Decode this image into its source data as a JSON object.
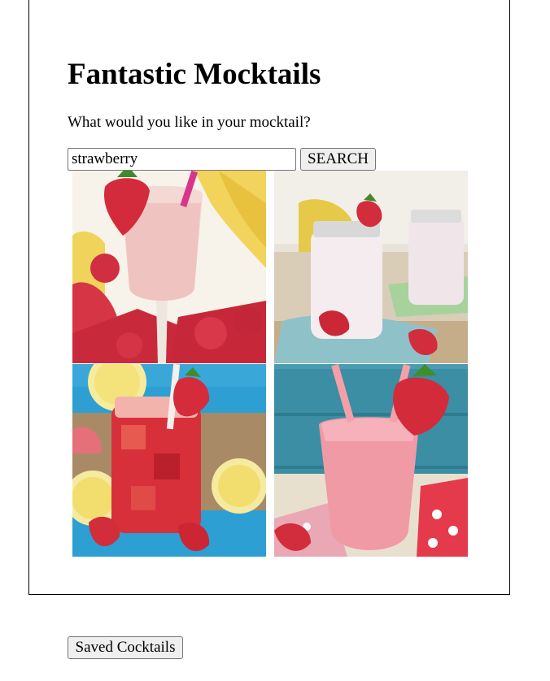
{
  "header": {
    "title": "Fantastic Mocktails",
    "prompt": "What would you like in your mocktail?"
  },
  "search": {
    "value": "strawberry",
    "button_label": "SEARCH"
  },
  "results": [
    {
      "image_subject": "strawberry banana smoothie in a tall glass"
    },
    {
      "image_subject": "strawberry milkshake in mason jars"
    },
    {
      "image_subject": "strawberry lemonade in a mason jar"
    },
    {
      "image_subject": "pink strawberry smoothie in a glass with straws"
    }
  ],
  "footer": {
    "saved_label": "Saved Cocktails"
  }
}
